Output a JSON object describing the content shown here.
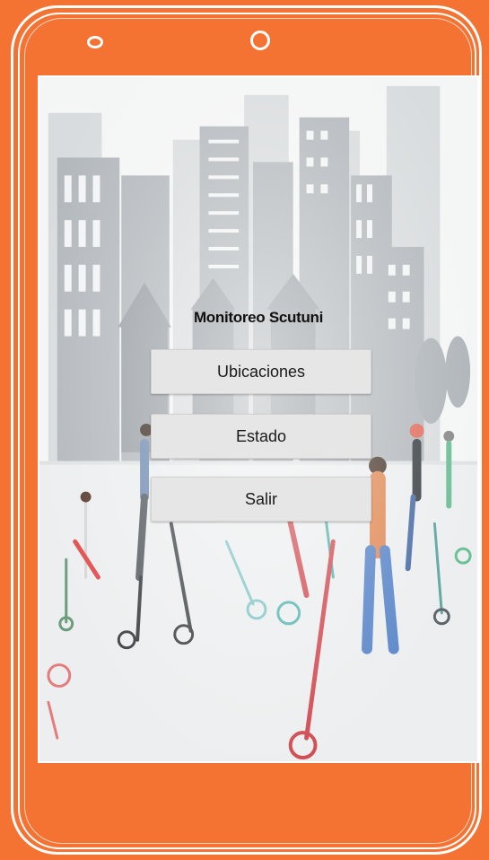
{
  "app": {
    "title": "Monitoreo Scutuni"
  },
  "menu": {
    "buttons": [
      {
        "label": "Ubicaciones"
      },
      {
        "label": "Estado"
      },
      {
        "label": "Salir"
      }
    ]
  },
  "colors": {
    "frame": "#f47232",
    "button_bg": "#e6e6e6",
    "text": "#111111"
  },
  "icons": {
    "speaker": "speaker-slot-icon",
    "camera": "front-camera-icon"
  }
}
